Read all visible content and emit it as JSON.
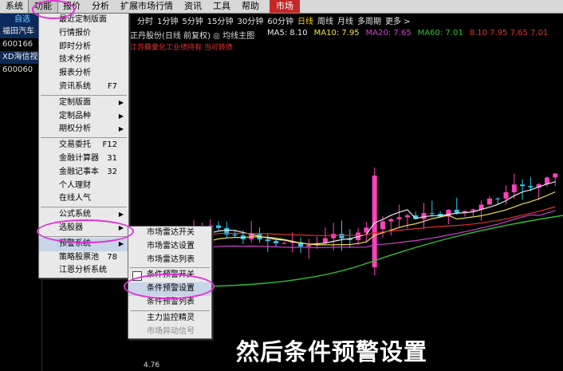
{
  "menubar": {
    "items": [
      "系统",
      "功能",
      "报价",
      "分析",
      "扩展市场行情",
      "资讯",
      "工具",
      "帮助"
    ],
    "market_tab": "市场"
  },
  "stock_list": {
    "header": "自选",
    "rows": [
      {
        "name": "福田汽车",
        "code": "600166"
      },
      {
        "name": "XD海信视",
        "code": "600060"
      }
    ]
  },
  "function_menu": {
    "items": [
      {
        "label": "最近定制版面",
        "shortcut": "",
        "arrow": false
      },
      {
        "label": "行情报价",
        "shortcut": "",
        "arrow": false
      },
      {
        "label": "即时分析",
        "shortcut": "",
        "arrow": false
      },
      {
        "label": "技术分析",
        "shortcut": "",
        "arrow": false
      },
      {
        "label": "报表分析",
        "shortcut": "",
        "arrow": false
      },
      {
        "label": "资讯系统",
        "shortcut": "F7",
        "arrow": false
      },
      {
        "label": "定制版面",
        "shortcut": "",
        "arrow": true
      },
      {
        "label": "定制品种",
        "shortcut": "",
        "arrow": true
      },
      {
        "label": "期权分析",
        "shortcut": "",
        "arrow": true
      },
      {
        "label": "交易委托",
        "shortcut": "F12",
        "arrow": false
      },
      {
        "label": "金融计算器",
        "shortcut": "31",
        "arrow": false
      },
      {
        "label": "金融记事本",
        "shortcut": "32",
        "arrow": false
      },
      {
        "label": "个人理财",
        "shortcut": "",
        "arrow": false
      },
      {
        "label": "在线人气",
        "shortcut": "",
        "arrow": false
      },
      {
        "label": "公式系统",
        "shortcut": "",
        "arrow": true
      },
      {
        "label": "选股器",
        "shortcut": "",
        "arrow": true
      },
      {
        "label": "预警系统",
        "shortcut": "",
        "arrow": true
      },
      {
        "label": "策略股票池",
        "shortcut": "78",
        "arrow": false
      },
      {
        "label": "江恩分析系统",
        "shortcut": "",
        "arrow": false
      }
    ]
  },
  "warning_submenu": {
    "items": [
      {
        "label": "市场雷达开关",
        "check": false,
        "grey": false
      },
      {
        "label": "市场雷达设置",
        "check": false,
        "grey": false
      },
      {
        "label": "市场雷达列表",
        "check": false,
        "grey": false
      },
      {
        "label": "条件预警开关",
        "check": true,
        "grey": false
      },
      {
        "label": "条件预警设置",
        "check": false,
        "grey": false
      },
      {
        "label": "条件预警列表",
        "check": false,
        "grey": false
      },
      {
        "label": "主力监控精灵",
        "check": false,
        "grey": false
      },
      {
        "label": "市场异动信号",
        "check": false,
        "grey": true
      }
    ]
  },
  "period_bar": {
    "items": [
      "分时",
      "1分钟",
      "5分钟",
      "15分钟",
      "30分钟",
      "60分钟",
      "日线",
      "周线",
      "月线",
      "多周期",
      "更多 >"
    ],
    "active": "日线"
  },
  "chart_info": "正丹股份(日线 前复权) ◎ 均线主图",
  "ma_legend": [
    {
      "label": "MA5: 8.10",
      "color": "#e8e8e8"
    },
    {
      "label": "MA10: 7.95",
      "color": "#f0e050"
    },
    {
      "label": "MA20: 7.65",
      "color": "#d040d0"
    },
    {
      "label": "MA60: 7.01",
      "color": "#30c030"
    },
    {
      "label": "8.10 7.95 7.65 7.01",
      "color": "#e03030"
    }
  ],
  "news_text": "江苏蘇彙化工业绩持有 当可转债",
  "bottom_price_label": "4.76",
  "caption": "然后条件预警设置",
  "colors": {
    "up": "#ff40c0",
    "down": "#2ec8f0",
    "highlight": "#e030d8"
  }
}
